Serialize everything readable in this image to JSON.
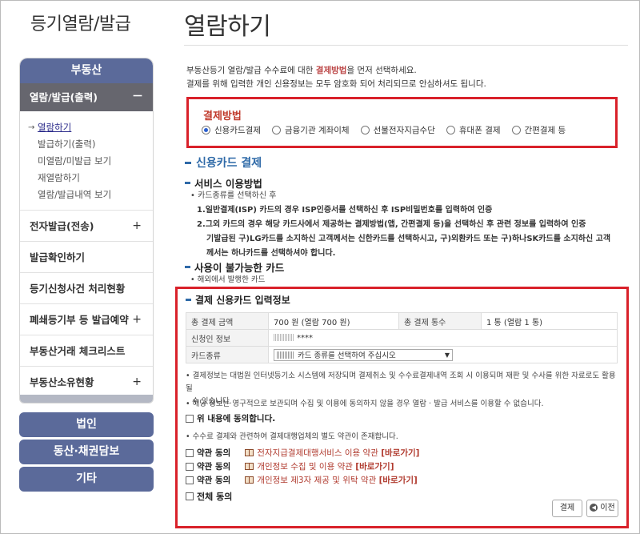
{
  "sidebar": {
    "title": "등기열람/발급",
    "header": "부동산",
    "open_section": {
      "label": "열람/발급(출력)",
      "toggle": "－"
    },
    "sub_items": [
      "열람하기",
      "발급하기(출력)",
      "미열람/미발급 보기",
      "재열람하기",
      "열람/발급내역 보기"
    ],
    "items": [
      {
        "label": "전자발급(전송)",
        "toggle": "+"
      },
      {
        "label": "발급확인하기",
        "toggle": ""
      },
      {
        "label": "등기신청사건 처리현황",
        "toggle": ""
      },
      {
        "label": "폐쇄등기부 등 발급예약",
        "toggle": "+"
      },
      {
        "label": "부동산거래 체크리스트",
        "toggle": ""
      },
      {
        "label": "부동산소유현황",
        "toggle": "+"
      }
    ],
    "buttons": [
      "법인",
      "동산·채권담보",
      "기타"
    ]
  },
  "main": {
    "title": "열람하기",
    "intro_line1_a": "부동산등기 열람/발급 수수료에 대한 ",
    "intro_line1_hl": "결제방법",
    "intro_line1_b": "을 먼저 선택하세요.",
    "intro_line2": "결제를 위해 입력한 개인 신용정보는 모두 암호화 되어 처리되므로 안심하셔도 됩니다.",
    "pay_method_title": "결제방법",
    "pay_methods": [
      "신용카드결제",
      "금융기관 계좌이체",
      "선불전자지급수단",
      "휴대폰 결제",
      "간편결제 등"
    ],
    "section_title": "신용카드 결제",
    "service_title": "서비스 이용방법",
    "service_notes": [
      "• 카드종류를 선택하신 후",
      "1.일반결제(ISP) 카드의 경우 ISP인증서를 선택하신 후 ISP비밀번호를 입력하여 인증",
      "2.그외 카드의 경우 해당 카드사에서 제공하는 결제방법(앱, 간편결제 등)을 선택하신 후 관련 정보를 입력하여 인증",
      "기발급된 구)LG카드를 소지하신 고객께서는 신한카드를 선택하시고, 구)외환카드 또는 구)하나SK카드를 소지하신 고객",
      "께서는 하나카드를 선택하셔야 합니다."
    ],
    "unavailable_title": "사용이 불가능한 카드",
    "unavailable_note": "• 해외에서 발행한 카드",
    "card_info_title": "결제 신용카드 입력정보",
    "table": {
      "total_amount_label": "총 결제 금액",
      "total_amount_value": "700 원 (열람 700 원)",
      "total_count_label": "총 결제 통수",
      "total_count_value": "1 통 (열람 1 통)",
      "applicant_label": "신청인 정보",
      "applicant_value": "****",
      "card_type_label": "카드종류",
      "card_select_placeholder": "카드 종류를 선택하여 주십시오"
    },
    "fine_print_1": "• 결제정보는 대법원 인터넷등기소 시스템에 저장되며 결제취소 및 수수료결제내역 조회 시 이용되며 재판 및 수사를 위한 자료로도 활용될",
    "fine_print_1b": "수 있습니다.",
    "fine_print_2": "• 해당 정보는 영구적으로 보관되며 수집 및 이용에 동의하지 않을 경우 열람 · 발급 서비스를 이용할 수 없습니다.",
    "agree_above": "위 내용에 동의합니다.",
    "fine_print_3": "• 수수료 결제와 관련하여 결제대행업체의 별도 약관이 존재합니다.",
    "terms": [
      {
        "label": "약관 동의",
        "text": "전자지급결제대행서비스 이용 약관",
        "link": "[바로가기]"
      },
      {
        "label": "약관 동의",
        "text": "개인정보 수집 및 이용 약관",
        "link": "[바로가기]"
      },
      {
        "label": "약관 동의",
        "text": "개인정보 제3자 제공 및 위탁 약관",
        "link": "[바로가기]"
      }
    ],
    "agree_all": "전체 동의",
    "pay_button": "결제",
    "prev_button": "이전"
  },
  "colors": {
    "accent": "#5b6a9a",
    "highlight_box": "#d9212a",
    "section": "#2f6aa8"
  }
}
